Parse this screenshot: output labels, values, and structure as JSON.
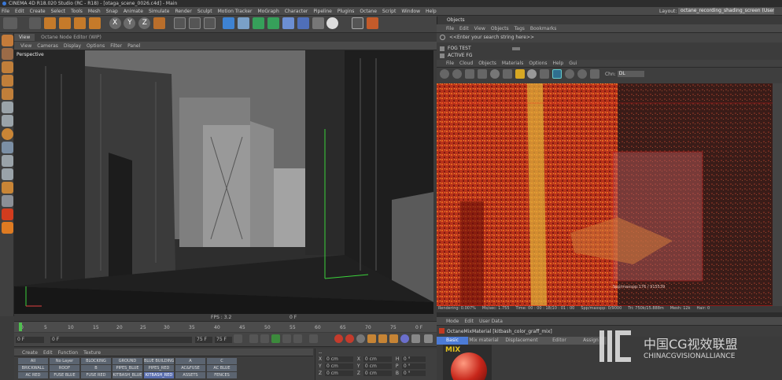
{
  "window": {
    "title": "CINEMA 4D R18.020 Studio (RC - R18) - [otaga_scene_0026.c4d] - Main"
  },
  "menubar": {
    "items": [
      "File",
      "Edit",
      "Create",
      "Select",
      "Tools",
      "Mesh",
      "Snap",
      "Animate",
      "Simulate",
      "Render",
      "Sculpt",
      "Motion Tracker",
      "MoGraph",
      "Character",
      "Pipeline",
      "Plugins",
      "Octane",
      "Script",
      "Window",
      "Help"
    ],
    "layout_label": "Layout:",
    "layout_value": "octane_recording_shading_screen (User)"
  },
  "toolbar": {
    "axes": [
      "X",
      "Y",
      "Z"
    ]
  },
  "viewport": {
    "tabs": [
      "View",
      "Octane Node Editor (WIP)"
    ],
    "menu": [
      "View",
      "Cameras",
      "Display",
      "Options",
      "Filter",
      "Panel"
    ],
    "label": "Perspective",
    "fps": "FPS : 3.2",
    "frame": "0 F"
  },
  "timeline": {
    "ticks": [
      "0",
      "5",
      "10",
      "15",
      "20",
      "25",
      "30",
      "35",
      "40",
      "45",
      "50",
      "55",
      "60",
      "65",
      "70",
      "75"
    ],
    "end": "0 F",
    "field_left": "0 F",
    "field_mid": "0 F",
    "field_right": "75 F",
    "field_right2": "75 F"
  },
  "materials": {
    "menu": [
      "Create",
      "Edit",
      "Function",
      "Texture"
    ],
    "tags": [
      [
        "All",
        "No Layer",
        "BLOCKING",
        "GROUND",
        "BLUE BUILDINGS",
        "A",
        "C"
      ],
      [
        "BRICKWALL",
        "ROOF",
        "B",
        "PIPES_BLUE",
        "PIPES_RED",
        "AC&FUSE",
        "AC BLUE"
      ],
      [
        "AC RED",
        "FUSE BLUE",
        "FUSE RED",
        "KITBASH_BLUE",
        "KITBASH_RED",
        "ASSETS",
        "FENCES"
      ]
    ],
    "selected": "KITBASH_RED"
  },
  "coords": {
    "headers": [
      "--"
    ],
    "rows": [
      [
        "X",
        "0 cm",
        "X",
        "0 cm",
        "H",
        "0 °"
      ],
      [
        "Y",
        "0 cm",
        "Y",
        "0 cm",
        "P",
        "0 °"
      ],
      [
        "Z",
        "0 cm",
        "Z",
        "0 cm",
        "B",
        "0 °"
      ]
    ]
  },
  "objects": {
    "title": "Objects",
    "menu": [
      "File",
      "Edit",
      "View",
      "Objects",
      "Tags",
      "Bookmarks"
    ],
    "search_placeholder": "<<Enter your search string here>>",
    "rows": [
      "FOG TEST",
      "ACTIVE FG"
    ]
  },
  "live_viewer": {
    "menu": [
      "File",
      "Cloud",
      "Objects",
      "Materials",
      "Options",
      "Help",
      "Gui"
    ],
    "channel_label": "Chn:",
    "channel_value": "DL",
    "overlay_text": "Spp/maxspp:176 / 915539",
    "status": [
      "Rendering: 0.007%",
      "Ms/sec: 1.755",
      "Time: 00 : 00 : 18/10 : 01 : 00",
      "Spp/maxspp: 0/9000",
      "Tri: 750k/15.888m",
      "Mesh: 12k",
      "Hair: 0"
    ]
  },
  "attributes": {
    "menu": [
      "Mode",
      "Edit",
      "User Data"
    ],
    "title": "OctaneMixMaterial [kitbash_color_graff_mix]",
    "tabs": [
      "Basic",
      "Mix material",
      "Displacement",
      "Editor",
      "Assign"
    ],
    "preview_label": "MIX"
  },
  "watermark": {
    "cn": "中国CG视效联盟",
    "en": "CHINACGVISIONALLIANCE"
  },
  "colors": {
    "accent": "#4c7bd6",
    "render_red": "#c4301a",
    "region": "#e01818"
  }
}
